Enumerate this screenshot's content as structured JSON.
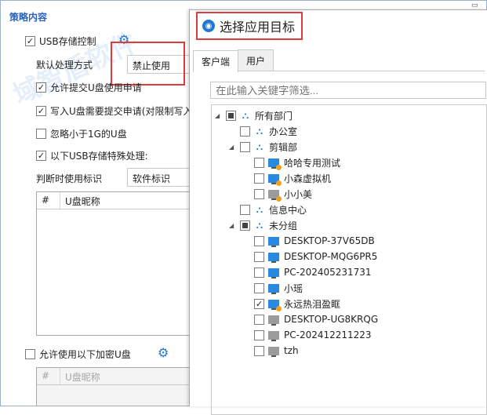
{
  "policy": {
    "title": "策略内容",
    "usb_storage_label": "USB存储控制",
    "default_handling_label": "默认处理方式",
    "default_handling_value": "禁止使用",
    "allow_request_label": "允许提交U盘使用申请",
    "write_request_label": "写入U盘需要提交申请(对限制写入",
    "ignore_small_label": "忽略小于1G的U盘",
    "special_label": "以下USB存储特殊处理:",
    "judge_label": "判断时使用标识",
    "judge_value": "软件标识",
    "grid1_headers": [
      "#",
      "U盘昵称"
    ],
    "encrypted_label": "允许使用以下加密U盘",
    "grid2_headers": [
      "#",
      "U盘昵称"
    ]
  },
  "dialog": {
    "title": "选择应用目标",
    "tabs": [
      "客户端",
      "用户"
    ],
    "search_placeholder": "在此输入关键字筛选...",
    "tree": [
      {
        "label": "所有部门",
        "type": "org",
        "level": 0,
        "expand": "collapse",
        "check": "partial"
      },
      {
        "label": "办公室",
        "type": "org",
        "level": 1,
        "expand": "",
        "check": "none"
      },
      {
        "label": "剪辑部",
        "type": "org",
        "level": 1,
        "expand": "collapse",
        "check": "none"
      },
      {
        "label": "哈哈专用测试",
        "type": "pc-warn",
        "level": 2,
        "expand": "",
        "check": "none"
      },
      {
        "label": "小森虚拟机",
        "type": "pc-warn",
        "level": 2,
        "expand": "",
        "check": "none"
      },
      {
        "label": "小小美",
        "type": "pc-gray-warn",
        "level": 2,
        "expand": "",
        "check": "none"
      },
      {
        "label": "信息中心",
        "type": "org",
        "level": 1,
        "expand": "",
        "check": "none"
      },
      {
        "label": "未分组",
        "type": "org",
        "level": 1,
        "expand": "collapse",
        "check": "partial"
      },
      {
        "label": "DESKTOP-37V65DB",
        "type": "pc",
        "level": 2,
        "expand": "",
        "check": "none"
      },
      {
        "label": "DESKTOP-MQG6PR5",
        "type": "pc",
        "level": 2,
        "expand": "",
        "check": "none"
      },
      {
        "label": "PC-202405231731",
        "type": "pc",
        "level": 2,
        "expand": "",
        "check": "none"
      },
      {
        "label": "小瑶",
        "type": "pc",
        "level": 2,
        "expand": "",
        "check": "none"
      },
      {
        "label": "永远热泪盈眶",
        "type": "pc-warn",
        "level": 2,
        "expand": "",
        "check": "checked"
      },
      {
        "label": "DESKTOP-UG8KRQG",
        "type": "pc-gray",
        "level": 2,
        "expand": "",
        "check": "none"
      },
      {
        "label": "PC-202412211223",
        "type": "pc-gray",
        "level": 2,
        "expand": "",
        "check": "none"
      },
      {
        "label": "tzh",
        "type": "pc-gray",
        "level": 2,
        "expand": "",
        "check": "none"
      }
    ]
  },
  "watermark": "域智盾软件",
  "colors": {
    "accent": "#1f78d1",
    "highlight": "#e03a3a"
  }
}
